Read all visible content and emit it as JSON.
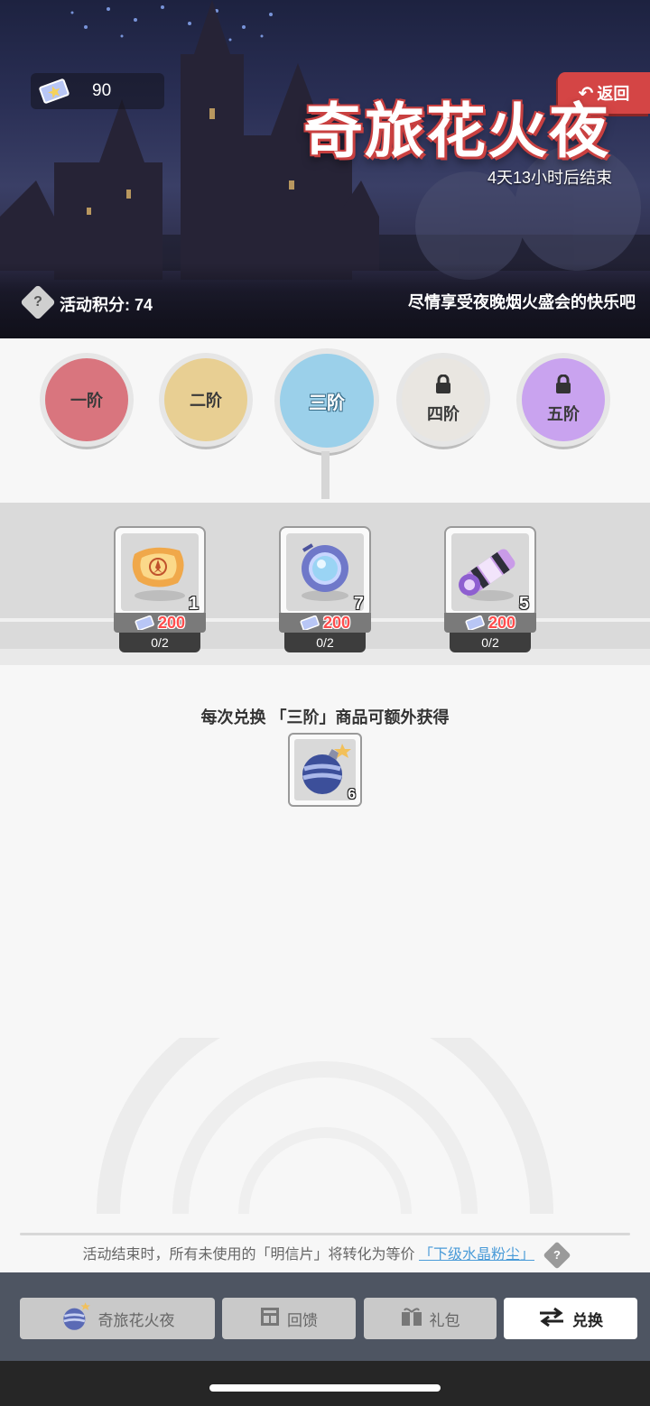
{
  "header": {
    "currency_amount": "90",
    "back_label": "返回",
    "title": "奇旅花火夜",
    "countdown": "4天13小时后结束",
    "score_label": "活动积分: 74",
    "slogan": "尽情享受夜晚烟火盛会的快乐吧"
  },
  "tiers": [
    {
      "label": "一阶",
      "locked": false,
      "selected": false,
      "color": "#d9757e"
    },
    {
      "label": "二阶",
      "locked": false,
      "selected": false,
      "color": "#e8cf93"
    },
    {
      "label": "三阶",
      "locked": false,
      "selected": true,
      "color": "#9bd0ea"
    },
    {
      "label": "四阶",
      "locked": true,
      "selected": false,
      "color": "#e9e6e1"
    },
    {
      "label": "五阶",
      "locked": true,
      "selected": false,
      "color": "#c9a3ef"
    }
  ],
  "shop_items": [
    {
      "icon": "scroll-map-icon",
      "count": "1",
      "price": "200",
      "limit": "0/2"
    },
    {
      "icon": "crystal-ring-icon",
      "count": "7",
      "price": "200",
      "limit": "0/2"
    },
    {
      "icon": "purple-scroll-icon",
      "count": "5",
      "price": "200",
      "limit": "0/2"
    }
  ],
  "bonus": {
    "text": "每次兑换 「三阶」商品可额外获得",
    "icon": "firework-bomb-icon",
    "count": "6"
  },
  "footer_note": {
    "text": "活动结束时，所有未使用的「明信片」将转化为等价",
    "link": "「下级水晶粉尘」"
  },
  "bottom_nav": [
    {
      "label": "奇旅花火夜",
      "icon": "firework-bomb-icon",
      "active": false
    },
    {
      "label": "回馈",
      "icon": "grid-icon",
      "active": false
    },
    {
      "label": "礼包",
      "icon": "gift-icon",
      "active": false
    },
    {
      "label": "兑换",
      "icon": "swap-icon",
      "active": true
    }
  ],
  "colors": {
    "accent_red": "#d44545",
    "price_red": "#ff4d4d",
    "link_blue": "#4a9bd8",
    "nav_bg": "#4e5562"
  }
}
